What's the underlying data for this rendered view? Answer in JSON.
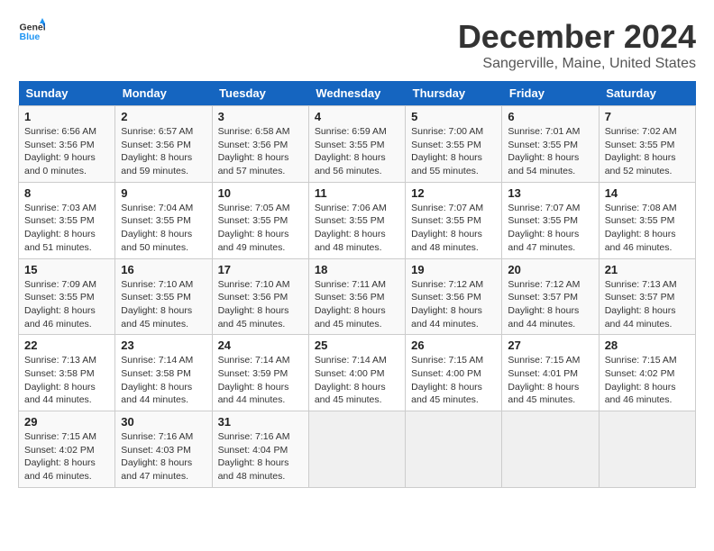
{
  "header": {
    "logo_line1": "General",
    "logo_line2": "Blue",
    "title": "December 2024",
    "subtitle": "Sangerville, Maine, United States"
  },
  "days_of_week": [
    "Sunday",
    "Monday",
    "Tuesday",
    "Wednesday",
    "Thursday",
    "Friday",
    "Saturday"
  ],
  "weeks": [
    [
      {
        "day": "1",
        "info": "Sunrise: 6:56 AM\nSunset: 3:56 PM\nDaylight: 9 hours and 0 minutes."
      },
      {
        "day": "2",
        "info": "Sunrise: 6:57 AM\nSunset: 3:56 PM\nDaylight: 8 hours and 59 minutes."
      },
      {
        "day": "3",
        "info": "Sunrise: 6:58 AM\nSunset: 3:56 PM\nDaylight: 8 hours and 57 minutes."
      },
      {
        "day": "4",
        "info": "Sunrise: 6:59 AM\nSunset: 3:55 PM\nDaylight: 8 hours and 56 minutes."
      },
      {
        "day": "5",
        "info": "Sunrise: 7:00 AM\nSunset: 3:55 PM\nDaylight: 8 hours and 55 minutes."
      },
      {
        "day": "6",
        "info": "Sunrise: 7:01 AM\nSunset: 3:55 PM\nDaylight: 8 hours and 54 minutes."
      },
      {
        "day": "7",
        "info": "Sunrise: 7:02 AM\nSunset: 3:55 PM\nDaylight: 8 hours and 52 minutes."
      }
    ],
    [
      {
        "day": "8",
        "info": "Sunrise: 7:03 AM\nSunset: 3:55 PM\nDaylight: 8 hours and 51 minutes."
      },
      {
        "day": "9",
        "info": "Sunrise: 7:04 AM\nSunset: 3:55 PM\nDaylight: 8 hours and 50 minutes."
      },
      {
        "day": "10",
        "info": "Sunrise: 7:05 AM\nSunset: 3:55 PM\nDaylight: 8 hours and 49 minutes."
      },
      {
        "day": "11",
        "info": "Sunrise: 7:06 AM\nSunset: 3:55 PM\nDaylight: 8 hours and 48 minutes."
      },
      {
        "day": "12",
        "info": "Sunrise: 7:07 AM\nSunset: 3:55 PM\nDaylight: 8 hours and 48 minutes."
      },
      {
        "day": "13",
        "info": "Sunrise: 7:07 AM\nSunset: 3:55 PM\nDaylight: 8 hours and 47 minutes."
      },
      {
        "day": "14",
        "info": "Sunrise: 7:08 AM\nSunset: 3:55 PM\nDaylight: 8 hours and 46 minutes."
      }
    ],
    [
      {
        "day": "15",
        "info": "Sunrise: 7:09 AM\nSunset: 3:55 PM\nDaylight: 8 hours and 46 minutes."
      },
      {
        "day": "16",
        "info": "Sunrise: 7:10 AM\nSunset: 3:55 PM\nDaylight: 8 hours and 45 minutes."
      },
      {
        "day": "17",
        "info": "Sunrise: 7:10 AM\nSunset: 3:56 PM\nDaylight: 8 hours and 45 minutes."
      },
      {
        "day": "18",
        "info": "Sunrise: 7:11 AM\nSunset: 3:56 PM\nDaylight: 8 hours and 45 minutes."
      },
      {
        "day": "19",
        "info": "Sunrise: 7:12 AM\nSunset: 3:56 PM\nDaylight: 8 hours and 44 minutes."
      },
      {
        "day": "20",
        "info": "Sunrise: 7:12 AM\nSunset: 3:57 PM\nDaylight: 8 hours and 44 minutes."
      },
      {
        "day": "21",
        "info": "Sunrise: 7:13 AM\nSunset: 3:57 PM\nDaylight: 8 hours and 44 minutes."
      }
    ],
    [
      {
        "day": "22",
        "info": "Sunrise: 7:13 AM\nSunset: 3:58 PM\nDaylight: 8 hours and 44 minutes."
      },
      {
        "day": "23",
        "info": "Sunrise: 7:14 AM\nSunset: 3:58 PM\nDaylight: 8 hours and 44 minutes."
      },
      {
        "day": "24",
        "info": "Sunrise: 7:14 AM\nSunset: 3:59 PM\nDaylight: 8 hours and 44 minutes."
      },
      {
        "day": "25",
        "info": "Sunrise: 7:14 AM\nSunset: 4:00 PM\nDaylight: 8 hours and 45 minutes."
      },
      {
        "day": "26",
        "info": "Sunrise: 7:15 AM\nSunset: 4:00 PM\nDaylight: 8 hours and 45 minutes."
      },
      {
        "day": "27",
        "info": "Sunrise: 7:15 AM\nSunset: 4:01 PM\nDaylight: 8 hours and 45 minutes."
      },
      {
        "day": "28",
        "info": "Sunrise: 7:15 AM\nSunset: 4:02 PM\nDaylight: 8 hours and 46 minutes."
      }
    ],
    [
      {
        "day": "29",
        "info": "Sunrise: 7:15 AM\nSunset: 4:02 PM\nDaylight: 8 hours and 46 minutes."
      },
      {
        "day": "30",
        "info": "Sunrise: 7:16 AM\nSunset: 4:03 PM\nDaylight: 8 hours and 47 minutes."
      },
      {
        "day": "31",
        "info": "Sunrise: 7:16 AM\nSunset: 4:04 PM\nDaylight: 8 hours and 48 minutes."
      },
      {
        "day": "",
        "info": ""
      },
      {
        "day": "",
        "info": ""
      },
      {
        "day": "",
        "info": ""
      },
      {
        "day": "",
        "info": ""
      }
    ]
  ]
}
